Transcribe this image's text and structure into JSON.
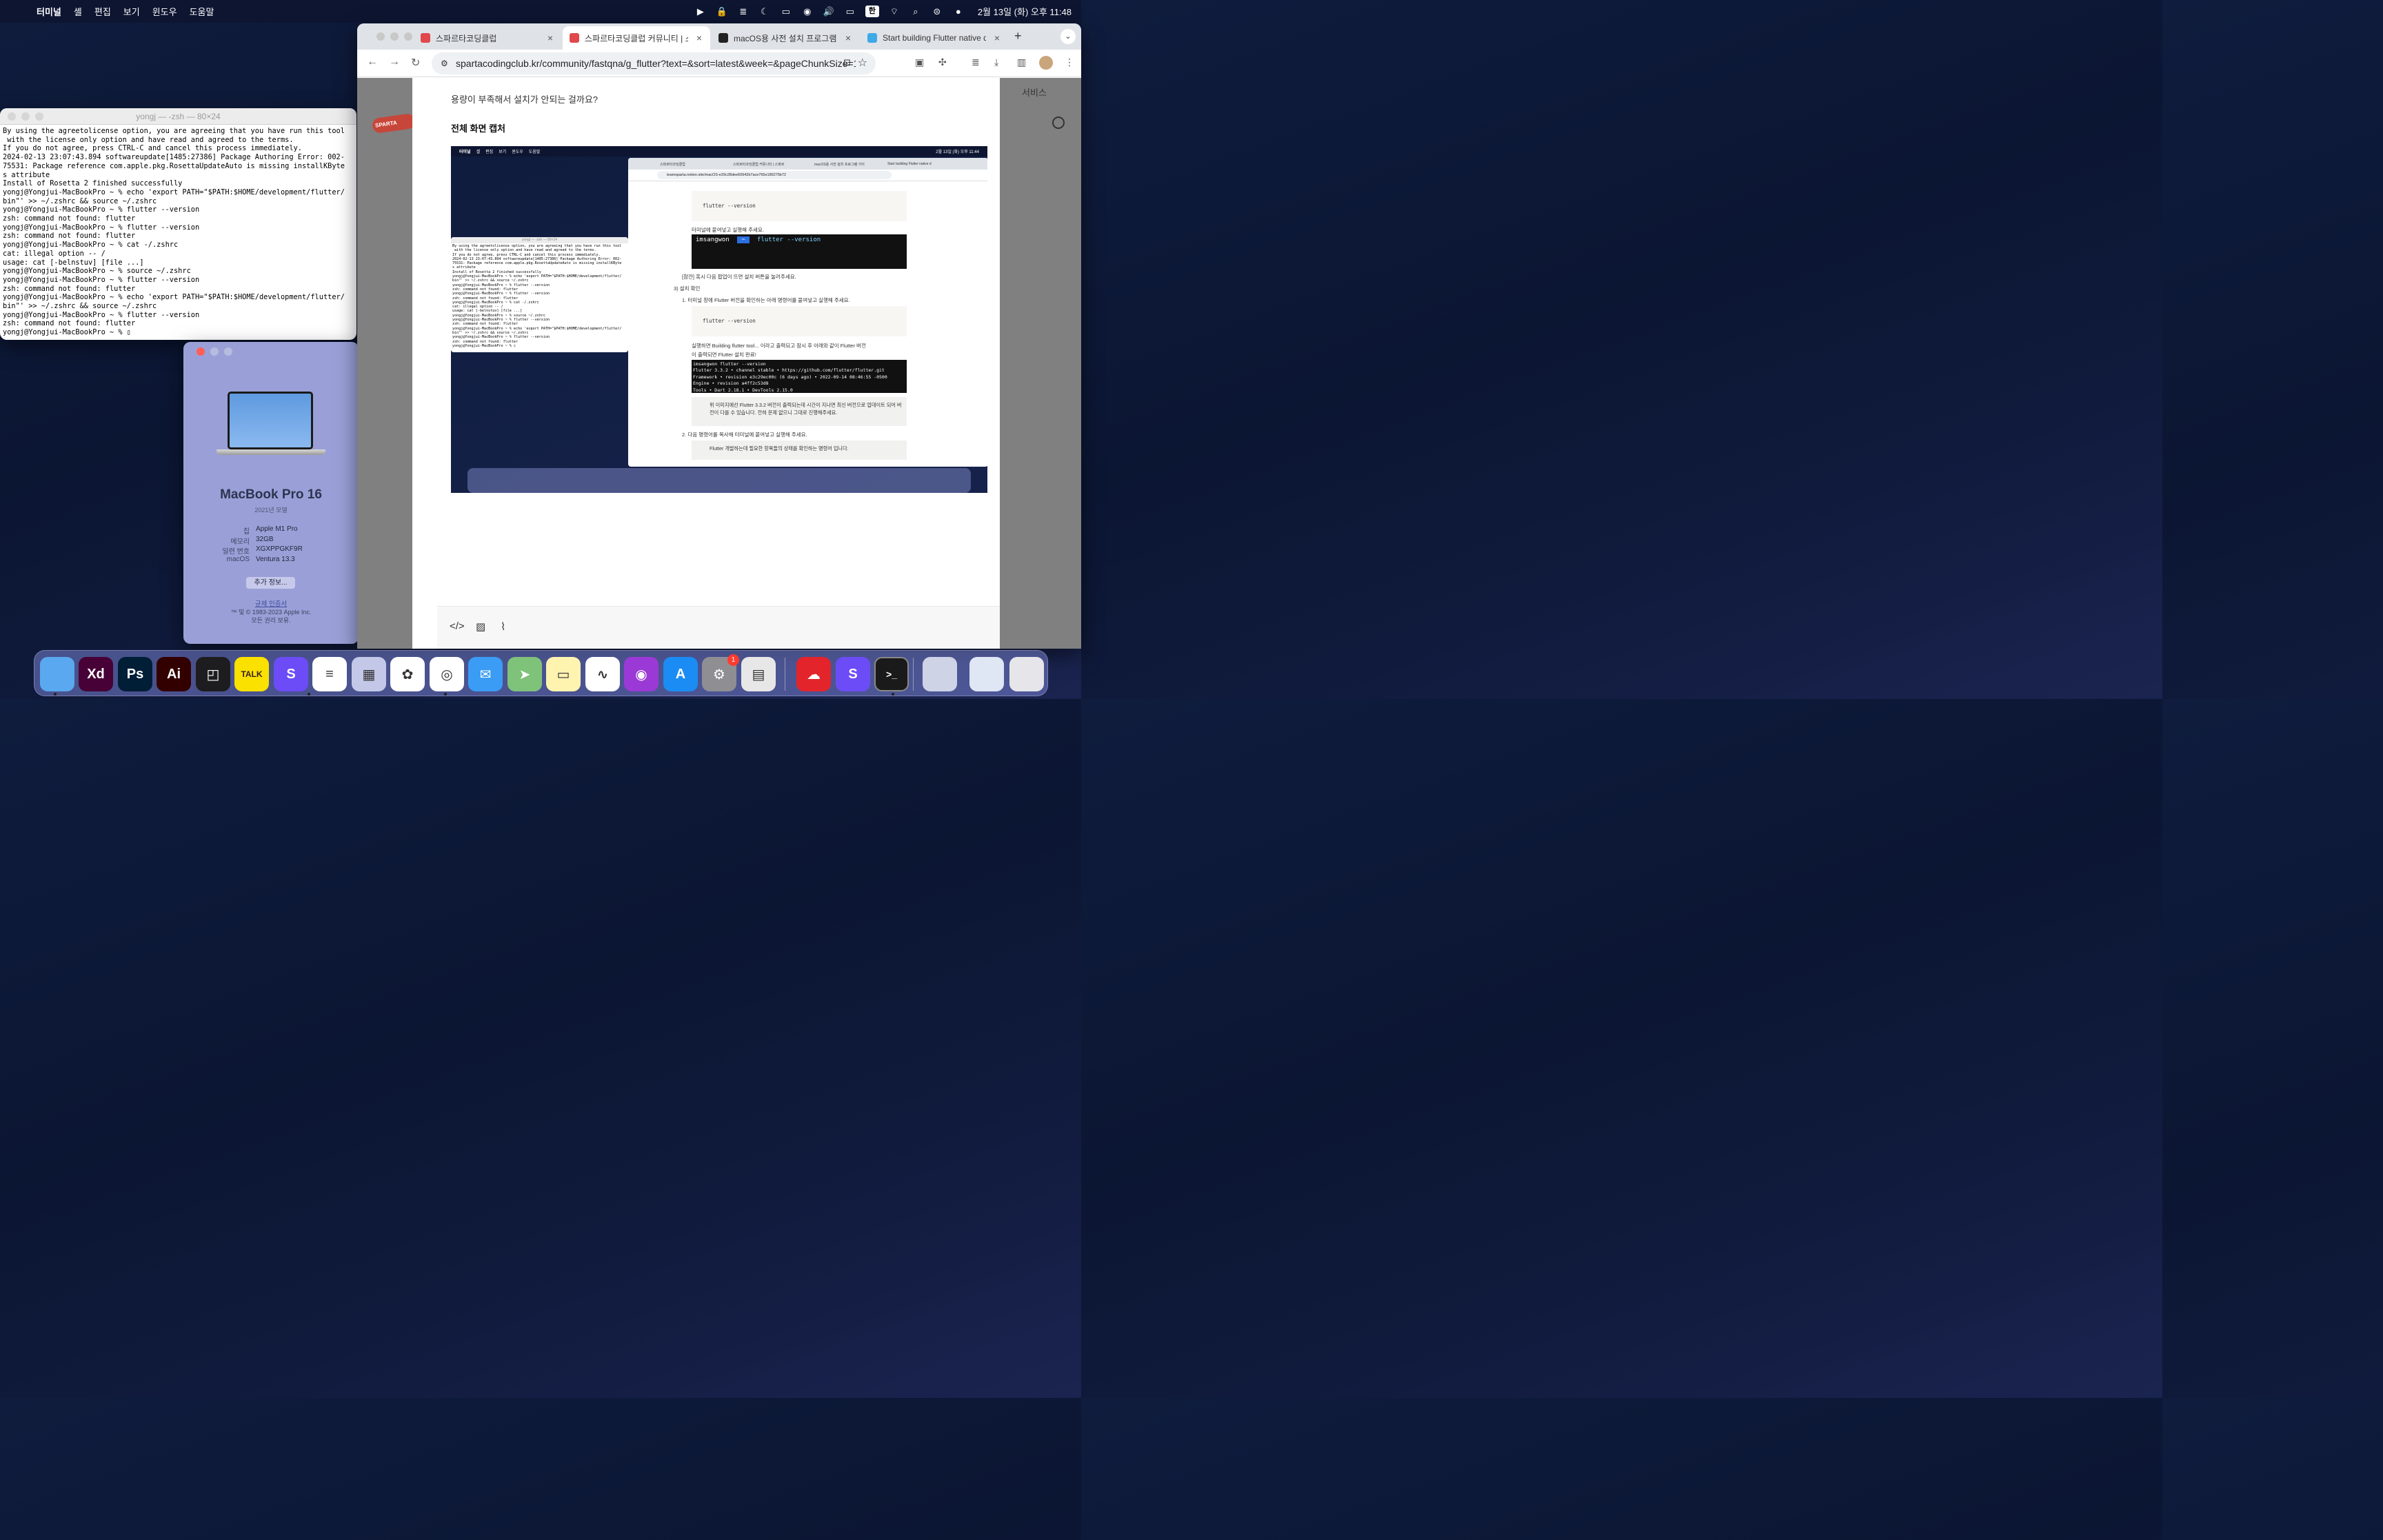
{
  "menubar": {
    "app": "터미널",
    "items": [
      "셸",
      "편집",
      "보기",
      "윈도우",
      "도움말"
    ],
    "ime": "한",
    "clock": "2월 13일 (화) 오후 11:48"
  },
  "terminal": {
    "title": "yongj — -zsh — 80×24",
    "lines": [
      "By using the agreetolicense option, you are agreeing that you have run this tool",
      " with the license only option and have read and agreed to the terms.",
      "If you do not agree, press CTRL-C and cancel this process immediately.",
      "2024-02-13 23:07:43.894 softwareupdate[1485:27386] Package Authoring Error: 002-",
      "75531: Package reference com.apple.pkg.RosettaUpdateAuto is missing installKByte",
      "s attribute",
      "Install of Rosetta 2 finished successfully",
      "yongj@Yongjui-MacBookPro ~ % echo 'export PATH=\"$PATH:$HOME/development/flutter/",
      "bin\"' >> ~/.zshrc && source ~/.zshrc",
      "yongj@Yongjui-MacBookPro ~ % flutter --version",
      "zsh: command not found: flutter",
      "yongj@Yongjui-MacBookPro ~ % flutter --version",
      "zsh: command not found: flutter",
      "yongj@Yongjui-MacBookPro ~ % cat -/.zshrc",
      "cat: illegal option -- /",
      "usage: cat [-belnstuv] [file ...]",
      "yongj@Yongjui-MacBookPro ~ % source ~/.zshrc",
      "yongj@Yongjui-MacBookPro ~ % flutter --version",
      "zsh: command not found: flutter",
      "yongj@Yongjui-MacBookPro ~ % echo 'export PATH=\"$PATH:$HOME/development/flutter/",
      "bin\"' >> ~/.zshrc && source ~/.zshrc",
      "yongj@Yongjui-MacBookPro ~ % flutter --version",
      "zsh: command not found: flutter",
      "yongj@Yongjui-MacBookPro ~ % ▯"
    ]
  },
  "about": {
    "model": "MacBook Pro 16",
    "year": "2021년 모델",
    "specs": [
      {
        "k": "칩",
        "v": "Apple M1 Pro"
      },
      {
        "k": "메모리",
        "v": "32GB"
      },
      {
        "k": "일련 번호",
        "v": "XGXPPGKF9R"
      },
      {
        "k": "macOS",
        "v": "Ventura 13.3"
      }
    ],
    "more_button": "추가 정보...",
    "regulatory": "규제 인증서",
    "copyright1": "™ 및 © 1983-2023 Apple Inc.",
    "copyright2": "모든 권리 보유."
  },
  "browser": {
    "tabs": [
      {
        "label": "스파르타코딩클럽"
      },
      {
        "label": "스파르타코딩클럽 커뮤니티 | 스파르"
      },
      {
        "label": "macOS용 사전 설치 프로그램 가이"
      },
      {
        "label": "Start building Flutter native d"
      }
    ],
    "url": "spartacodingclub.kr/community/fastqna/g_flutter?text=&sort=latest&week=&pageChunkSize=1...",
    "page": {
      "logo": "SPARTA",
      "service": "서비스",
      "question": "용량이 부족해서 설치가 안되는 걸까요?",
      "heading": "전체 화면 캡처"
    }
  },
  "embedded": {
    "menu": [
      "터미널",
      "셸",
      "편집",
      "보기",
      "윈도우",
      "도움말"
    ],
    "clock": "2월 13일 (화) 오후 11:44",
    "terminal_title": "yongj — -zsh — 80×24",
    "tabs": [
      "스파르타코딩클럽",
      "스파르타코딩클럽 커뮤니티 | 스파르",
      "macOS용 사전 설치 프로그램 가이",
      "Start building Flutter native d"
    ],
    "url": "teamsparta.notion.site/macOS-e29c28dee60942b7ace765e189275b72",
    "code1": "flutter --version",
    "paste_run": "터미널에 붙여넣고 실행해 주세요.",
    "prompt_user": "imsangwon",
    "prompt_cmd": "flutter --version",
    "popup_tip": "[참깐] 혹시 다음 팝업이 뜨면 설치 버튼을 눌러주세요.",
    "section": "3) 설치 확인",
    "step1": "1.  터미널 창에 Flutter 버전을 확인하는 아래 명령어를 붙여넣고 실행해 주세요.",
    "code2": "flutter --version",
    "result1": "실행하면 Building flutter tool... 이라고 출력되고 잠시 후 아래와 같이 Flutter 버전",
    "result2": "이 출력되면 Flutter 설치 완료!",
    "out": [
      "imsangwon  flutter --version",
      "Flutter 3.3.2 • channel stable • https://github.com/flutter/flutter.git",
      "Framework • revision e3c29ec00c (6 days ago) • 2022-09-14 08:46:55 -0500",
      "Engine • revision a4ff2c53d8",
      "Tools • Dart 2.18.1 • DevTools 2.15.0"
    ],
    "callout1": "위 이미지에선 Flutter 3.3.2 버전이 출력되는데 시간이 지나면 최신 버전으로 업데이트 되어 버전이 다를 수 있습니다. 전혀 문제 없으니 그대로 진행해주세요.",
    "step2": "2.  다음 명령어를 복사해 터미널에 붙여넣고 실행해 주세요.",
    "callout2": "Flutter 개발하는데 필요한 항목들의 상태를 확인하는 명령어 입니다."
  },
  "dock": {
    "apps": [
      {
        "name": "finder-app",
        "label": "",
        "color": "#5aa8f0"
      },
      {
        "name": "adobe-xd-app",
        "label": "Xd",
        "color": "#470137"
      },
      {
        "name": "photoshop-app",
        "label": "Ps",
        "color": "#001e36"
      },
      {
        "name": "illustrator-app",
        "label": "Ai",
        "color": "#330000"
      },
      {
        "name": "capcut-app",
        "label": "◰",
        "color": "#1d1d1f"
      },
      {
        "name": "kakaotalk-app",
        "label": "TALK",
        "color": "#fae100"
      },
      {
        "name": "spartacodingclub-app",
        "label": "S",
        "color": "#6c4cf6"
      },
      {
        "name": "stacks-app",
        "label": "≡",
        "color": "#ffffff"
      },
      {
        "name": "launchpad-app",
        "label": "▦",
        "color": "#c3c8e8"
      },
      {
        "name": "photos-app",
        "label": "✿",
        "color": "#ffffff"
      },
      {
        "name": "chrome-app",
        "label": "◎",
        "color": "#ffffff"
      },
      {
        "name": "mail-app",
        "label": "✉",
        "color": "#3a9cf5"
      },
      {
        "name": "maps-app",
        "label": "➤",
        "color": "#7fc27a"
      },
      {
        "name": "notes-app",
        "label": "▭",
        "color": "#fff3b0"
      },
      {
        "name": "freeform-app",
        "label": "∿",
        "color": "#ffffff"
      },
      {
        "name": "podcasts-app",
        "label": "◉",
        "color": "#9b39d6"
      },
      {
        "name": "app-store-app",
        "label": "A",
        "color": "#1b8cf3"
      },
      {
        "name": "system-settings-app",
        "label": "⚙",
        "color": "#8e8e93"
      },
      {
        "name": "calculator-app",
        "label": "▤",
        "color": "#e7e7e7"
      },
      {
        "name": "creative-cloud-app",
        "label": "☁",
        "color": "#e3242b"
      },
      {
        "name": "spartacodingclub-app-2",
        "label": "S",
        "color": "#6c4cf6"
      },
      {
        "name": "terminal-app",
        "label": ">_",
        "color": "#1a1a1a"
      },
      {
        "name": "downloads-stack",
        "label": "",
        "color": "#cfd3e6"
      },
      {
        "name": "screenshots-stack",
        "label": "",
        "color": "#dfe6f4"
      },
      {
        "name": "trash",
        "label": "",
        "color": "#e6e6ea"
      }
    ],
    "badge": "1"
  }
}
